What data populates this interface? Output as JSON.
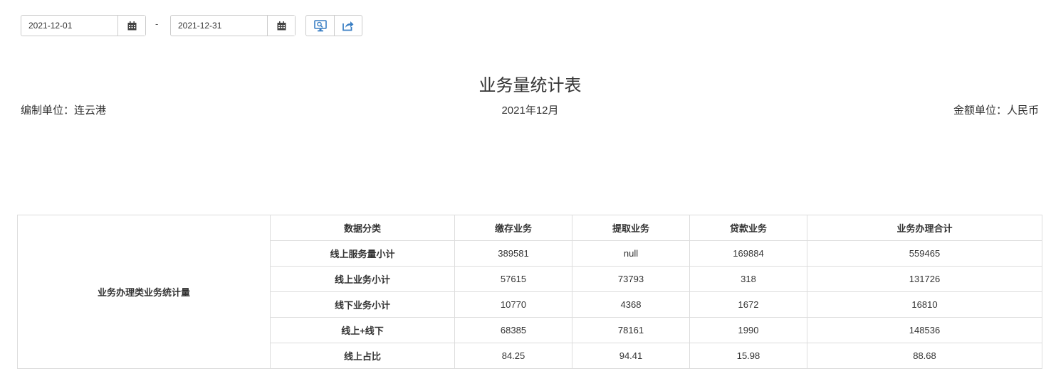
{
  "toolbar": {
    "start_date": "2021-12-01",
    "end_date": "2021-12-31",
    "separator": "-",
    "buttons": [
      {
        "icon": "monitor-display-icon"
      },
      {
        "icon": "share-export-icon"
      }
    ]
  },
  "report": {
    "title": "业务量统计表",
    "unit_left": "编制单位：连云港",
    "period": "2021年12月",
    "unit_right": "金额单位：人民币"
  },
  "table": {
    "group_label": "业务办理类业务统计量",
    "headers": [
      "数据分类",
      "缴存业务",
      "提取业务",
      "贷款业务",
      "业务办理合计"
    ],
    "rows": [
      {
        "label": "线上服务量小计",
        "values": [
          "389581",
          "null",
          "169884",
          "559465"
        ]
      },
      {
        "label": "线上业务小计",
        "values": [
          "57615",
          "73793",
          "318",
          "131726"
        ]
      },
      {
        "label": "线下业务小计",
        "values": [
          "10770",
          "4368",
          "1672",
          "16810"
        ]
      },
      {
        "label": "线上+线下",
        "values": [
          "68385",
          "78161",
          "1990",
          "148536"
        ]
      },
      {
        "label": "线上占比",
        "values": [
          "84.25",
          "94.41",
          "15.98",
          "88.68"
        ]
      }
    ]
  },
  "colors": {
    "border": "#dddddd",
    "icon_blue": "#3a7fc4"
  }
}
